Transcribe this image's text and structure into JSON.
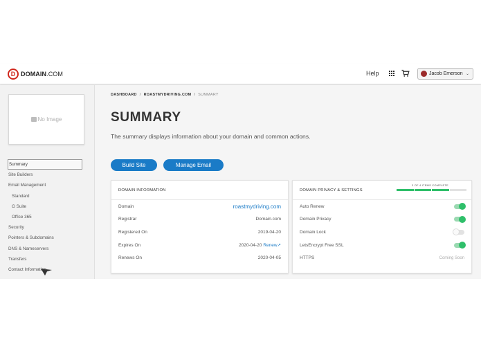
{
  "header": {
    "logo_mark": "D",
    "logo_domain": "DOMAIN",
    "logo_tld": ".COM",
    "help": "Help",
    "user_name": "Jacob Emerson"
  },
  "sidebar": {
    "no_image": "No Image",
    "items": [
      {
        "label": "Summary",
        "active": true,
        "sub": false
      },
      {
        "label": "Site Builders",
        "sub": false
      },
      {
        "label": "Email Management",
        "sub": false
      },
      {
        "label": "Standard",
        "sub": true
      },
      {
        "label": "G Suite",
        "sub": true
      },
      {
        "label": "Office 365",
        "sub": true
      },
      {
        "label": "Security",
        "sub": false
      },
      {
        "label": "Pointers & Subdomains",
        "sub": false
      },
      {
        "label": "DNS & Nameservers",
        "sub": false
      },
      {
        "label": "Transfers",
        "sub": false
      },
      {
        "label": "Contact Information",
        "sub": false
      }
    ]
  },
  "breadcrumb": {
    "dashboard": "DASHBOARD",
    "domain": "ROASTMYDRIVING.COM",
    "current": "SUMMARY",
    "separator": "/"
  },
  "page": {
    "title": "SUMMARY",
    "description": "The summary displays information about your domain and common actions."
  },
  "actions": {
    "build_site": "Build Site",
    "manage_email": "Manage Email"
  },
  "domain_info": {
    "heading": "DOMAIN INFORMATION",
    "rows": [
      {
        "label": "Domain",
        "value": "roastmydriving.com"
      },
      {
        "label": "Registrar",
        "value": "Domain.com"
      },
      {
        "label": "Registered On",
        "value": "2019-04-20"
      },
      {
        "label": "Expires On",
        "value": "2020-04-20",
        "action": "Renew"
      },
      {
        "label": "Renews On",
        "value": "2020-04-05"
      }
    ]
  },
  "privacy": {
    "heading": "DOMAIN PRIVACY & SETTINGS",
    "progress_label": "3 OF 4 ITEMS COMPLETE",
    "progress_done": 3,
    "progress_total": 4,
    "rows": [
      {
        "label": "Auto Renew",
        "state": "on"
      },
      {
        "label": "Domain Privacy",
        "state": "on"
      },
      {
        "label": "Domain Lock",
        "state": "off"
      },
      {
        "label": "LetsEncrypt Free SSL",
        "state": "on"
      },
      {
        "label": "HTTPS",
        "status": "Coming Soon"
      }
    ]
  },
  "colors": {
    "accent": "#1a7bc7",
    "success": "#2fbf6a",
    "brand": "#d0271d"
  }
}
